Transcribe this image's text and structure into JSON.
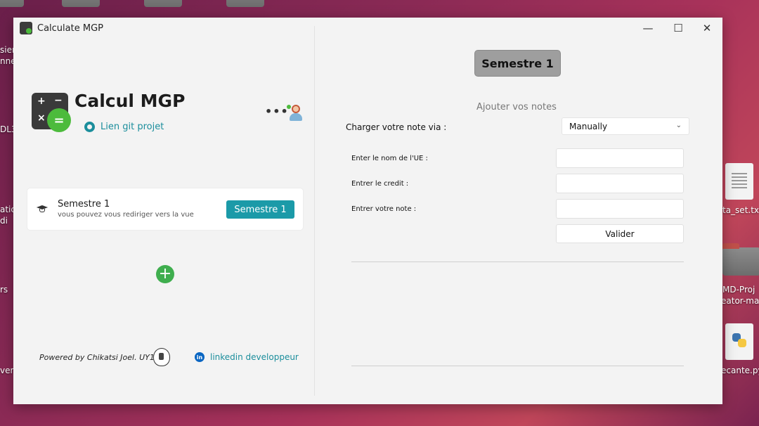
{
  "desktop": {
    "left_labels": [
      "sier",
      "nne",
      "DL3",
      "atic",
      "di",
      "rs",
      "ver"
    ],
    "right_labels": [
      "ta_set.tx",
      "MD-Proj",
      "eator-ma",
      "ecante.py"
    ]
  },
  "window": {
    "title": "Calculate MGP",
    "controls": {
      "minimize": "—",
      "maximize": "☐",
      "close": "✕"
    }
  },
  "left": {
    "app_name": "Calcul MGP",
    "git_link": "Lien git projet",
    "more": "•••",
    "semester_card": {
      "title": "Semestre 1",
      "subtitle": "vous pouvez vous rediriger vers la vue",
      "button": "Semestre 1"
    },
    "add_button": "+",
    "powered_by": "Powered by Chikatsi Joel. UY1",
    "linkedin": "linkedin developpeur"
  },
  "right": {
    "semester_header": "Semestre 1",
    "add_notes": "Ajouter vos notes",
    "load_label": "Charger votre note via  :",
    "load_select_value": "Manually",
    "fields": {
      "ue_label": "Enter le nom de l'UE :",
      "credit_label": "Entrer le credit :",
      "note_label": "Entrer votre note :"
    },
    "validate_button": "Valider"
  },
  "colors": {
    "accent": "#1b9aa8",
    "link": "#1b8e9c",
    "add_green": "#3fae4e",
    "header_gray": "#9e9e9e"
  }
}
